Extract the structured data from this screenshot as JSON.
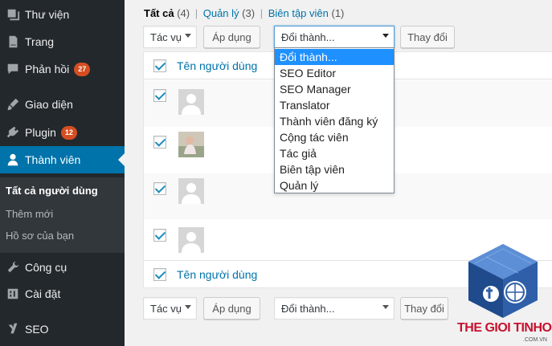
{
  "sidebar": {
    "items": [
      {
        "label": "Thư viện",
        "icon": "media-icon"
      },
      {
        "label": "Trang",
        "icon": "page-icon"
      },
      {
        "label": "Phản hồi",
        "icon": "comments-icon",
        "badge": "27"
      },
      {
        "label": "Giao diện",
        "icon": "appearance-icon"
      },
      {
        "label": "Plugin",
        "icon": "plugin-icon",
        "badge": "12"
      },
      {
        "label": "Thành viên",
        "icon": "users-icon"
      },
      {
        "label": "Công cụ",
        "icon": "tools-icon"
      },
      {
        "label": "Cài đặt",
        "icon": "settings-icon"
      },
      {
        "label": "SEO",
        "icon": "yoast-icon"
      }
    ],
    "submenu": [
      "Tất cả người dùng",
      "Thêm mới",
      "Hồ sơ của bạn"
    ]
  },
  "filters": {
    "all": "Tất cả",
    "all_count": "(4)",
    "admin": "Quản lý",
    "admin_count": "(3)",
    "editor": "Biên tập viên",
    "editor_count": "(1)",
    "separator": "|"
  },
  "toolbar": {
    "bulk_select": "Tác vụ",
    "apply_button": "Áp dụng",
    "role_select": "Đổi thành...",
    "change_button": "Thay đổi",
    "change_button_bottom": "Thay đổi"
  },
  "table": {
    "header_title": "Tên người dùng",
    "footer_title": "Tên người dùng"
  },
  "dropdown_options": [
    "Đổi thành...",
    "SEO Editor",
    "SEO Manager",
    "Translator",
    "Thành viên đăng ký",
    "Cộng tác viên",
    "Tác giả",
    "Biên tập viên",
    "Quản lý"
  ],
  "watermark": {
    "brand": "THE GIOI TINHOC",
    "domain": ".COM.VN"
  },
  "colors": {
    "sidebar_bg": "#23282d",
    "accent": "#0073aa",
    "badge": "#d54e21",
    "selected_option": "#1e90ff"
  }
}
